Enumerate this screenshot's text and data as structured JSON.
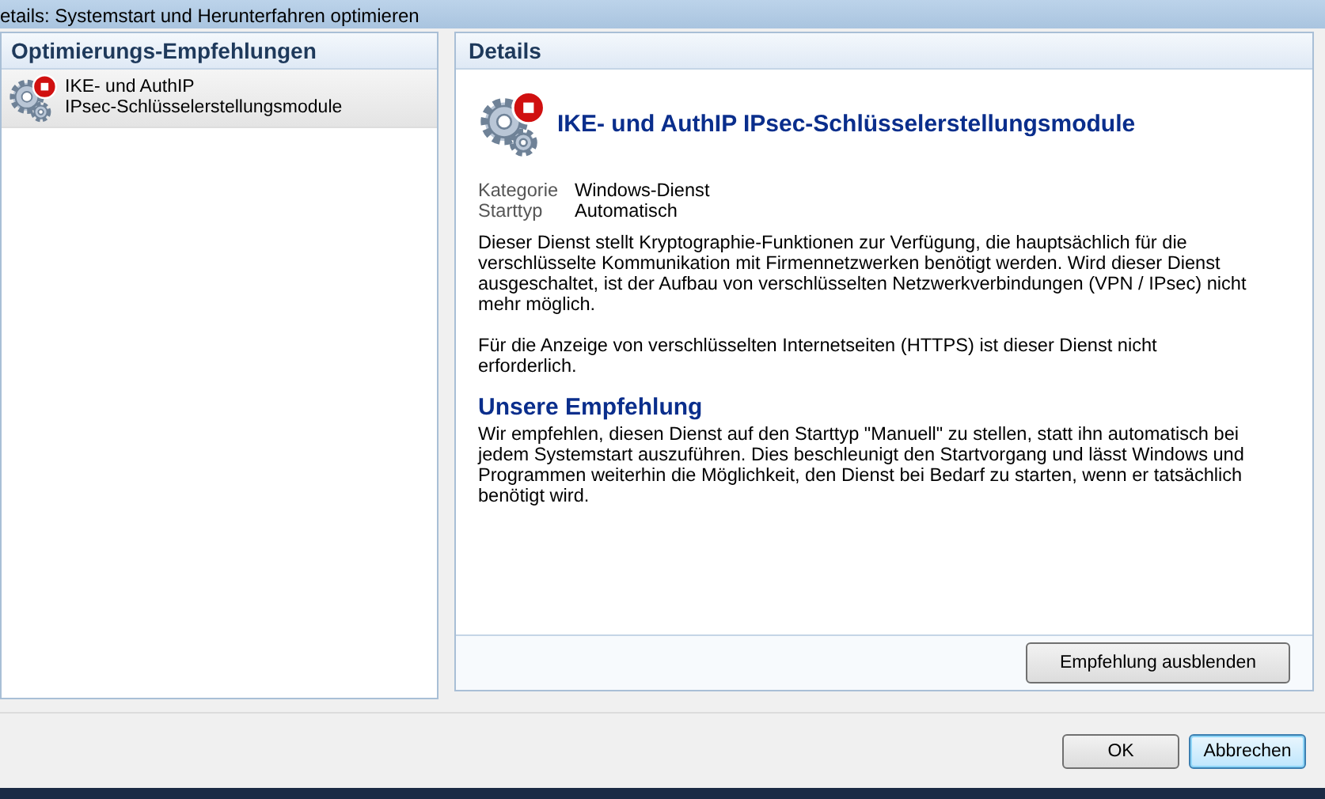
{
  "window": {
    "title": "etails: Systemstart und Herunterfahren optimieren"
  },
  "recommendations": {
    "heading": "Optimierungs-Empfehlungen",
    "items": [
      {
        "line_1": "IKE- und AuthIP",
        "line_2": "IPsec-Schlüsselerstellungsmodule",
        "selected": true
      }
    ]
  },
  "details": {
    "heading": "Details",
    "title": "IKE- und AuthIP IPsec-Schlüsselerstellungsmodule",
    "properties": [
      {
        "label": "Kategorie",
        "value": "Windows-Dienst"
      },
      {
        "label": "Starttyp",
        "value": "Automatisch"
      }
    ],
    "paragraphs": [
      "Dieser Dienst stellt Kryptographie-Funktionen zur Verfügung, die hauptsächlich für die verschlüsselte Kommunikation mit Firmennetzwerken benötigt werden. Wird dieser Dienst ausgeschaltet, ist der Aufbau von verschlüsselten Netzwerkverbindungen (VPN / IPsec) nicht mehr möglich.",
      "Für die Anzeige von verschlüsselten Internetseiten (HTTPS) ist dieser Dienst nicht erforderlich."
    ],
    "recommendation_heading": "Unsere Empfehlung",
    "recommendation_text": "Wir empfehlen, diesen Dienst auf den Starttyp \"Manuell\" zu stellen, statt ihn automatisch bei jedem Systemstart auszuführen. Dies beschleunigt den Startvorgang und lässt Windows und Programmen weiterhin die Möglichkeit, den Dienst bei Bedarf zu starten, wenn er tatsächlich benötigt wird.",
    "hide_button": "Empfehlung ausblenden"
  },
  "buttons": [
    {
      "label": "OK",
      "focused": false
    },
    {
      "label": "Abbrechen",
      "focused": true
    }
  ]
}
